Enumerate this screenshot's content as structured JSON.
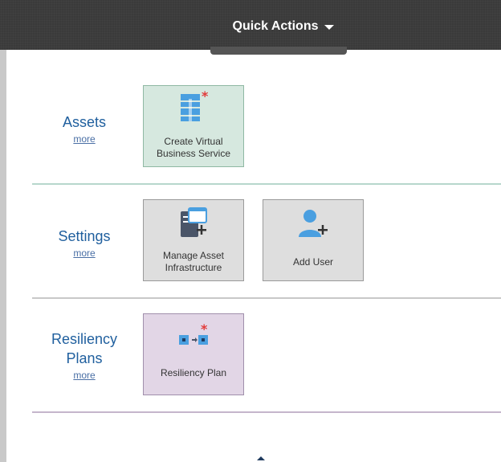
{
  "header": {
    "quick_actions_label": "Quick Actions"
  },
  "sections": {
    "assets": {
      "title": "Assets",
      "more": "more",
      "tiles": [
        {
          "label": "Create Virtual Business Service",
          "icon": "virtual-business-service-icon"
        }
      ]
    },
    "settings": {
      "title": "Settings",
      "more": "more",
      "tiles": [
        {
          "label": "Manage Asset Infrastructure",
          "icon": "asset-infrastructure-icon"
        },
        {
          "label": "Add User",
          "icon": "add-user-icon"
        }
      ]
    },
    "resiliency": {
      "title": "Resiliency Plans",
      "more": "more",
      "tiles": [
        {
          "label": "Resiliency Plan",
          "icon": "resiliency-plan-icon"
        }
      ]
    }
  },
  "colors": {
    "topbar": "#3a3a3a",
    "section_title": "#1f5f9e",
    "tile_green": "#d6e8df",
    "tile_gray": "#dedede",
    "tile_purple": "#e2d6e6",
    "icon_blue": "#4a9fe0",
    "icon_dark": "#4a5568",
    "accent_red": "#e23a3a"
  }
}
